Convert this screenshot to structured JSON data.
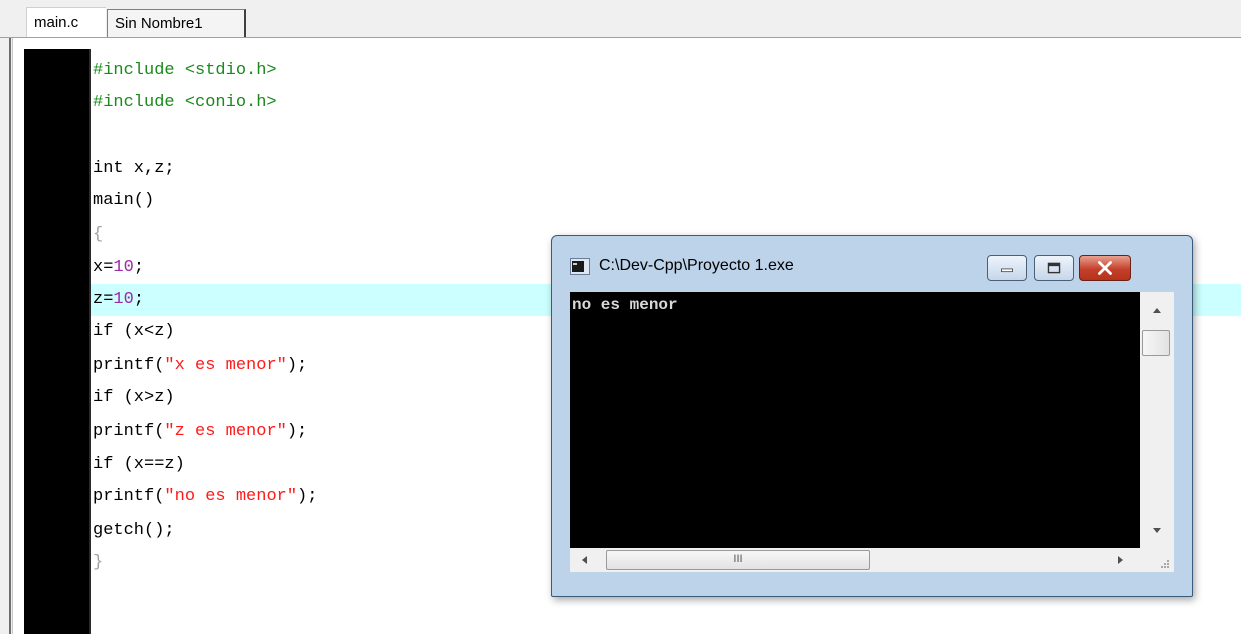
{
  "tabs": [
    {
      "label": "main.c",
      "active": true
    },
    {
      "label": "Sin Nombre1",
      "active": false
    }
  ],
  "editor": {
    "highlighted_line": 8,
    "lines": [
      "#include <stdio.h>",
      "#include <conio.h>",
      "",
      "int x,z;",
      "main()",
      "{",
      "x=10;",
      "z=10;",
      "if (x<z)",
      "printf(\"x es menor\");",
      "if (x>z)",
      "printf(\"z es menor\");",
      "if (x==z)",
      "printf(\"no es menor\");",
      "getch();",
      "}"
    ]
  },
  "console": {
    "title": "C:\\Dev-Cpp\\Proyecto 1.exe",
    "output": "no es menor",
    "hscroll_thumb_glyph": "III"
  },
  "colors": {
    "preprocessor": "#1b8a1b",
    "string": "#ff1a1a",
    "number": "#9c2aa6",
    "highlight": "#ccffff"
  },
  "icons": {
    "console_icon": "console-window-icon",
    "minimize": "minimize-icon",
    "maximize": "maximize-icon",
    "close": "close-icon"
  }
}
